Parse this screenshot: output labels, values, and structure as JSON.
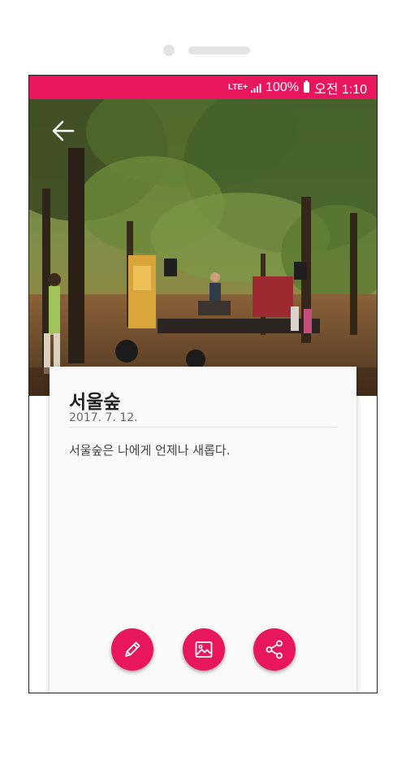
{
  "status_bar": {
    "network": "LTE",
    "network_plus": "+",
    "battery": "100%",
    "time": "오전 1:10"
  },
  "header": {
    "back_icon": "arrow-left-icon"
  },
  "entry": {
    "title": "서울숲",
    "date": "2017. 7. 12.",
    "content": "서울숲은 나에게 언제나 새롭다."
  },
  "actions": [
    {
      "icon": "pencil-icon"
    },
    {
      "icon": "image-icon"
    },
    {
      "icon": "share-icon"
    }
  ],
  "colors": {
    "accent": "#e8175d",
    "card_background": "#fafafa"
  }
}
